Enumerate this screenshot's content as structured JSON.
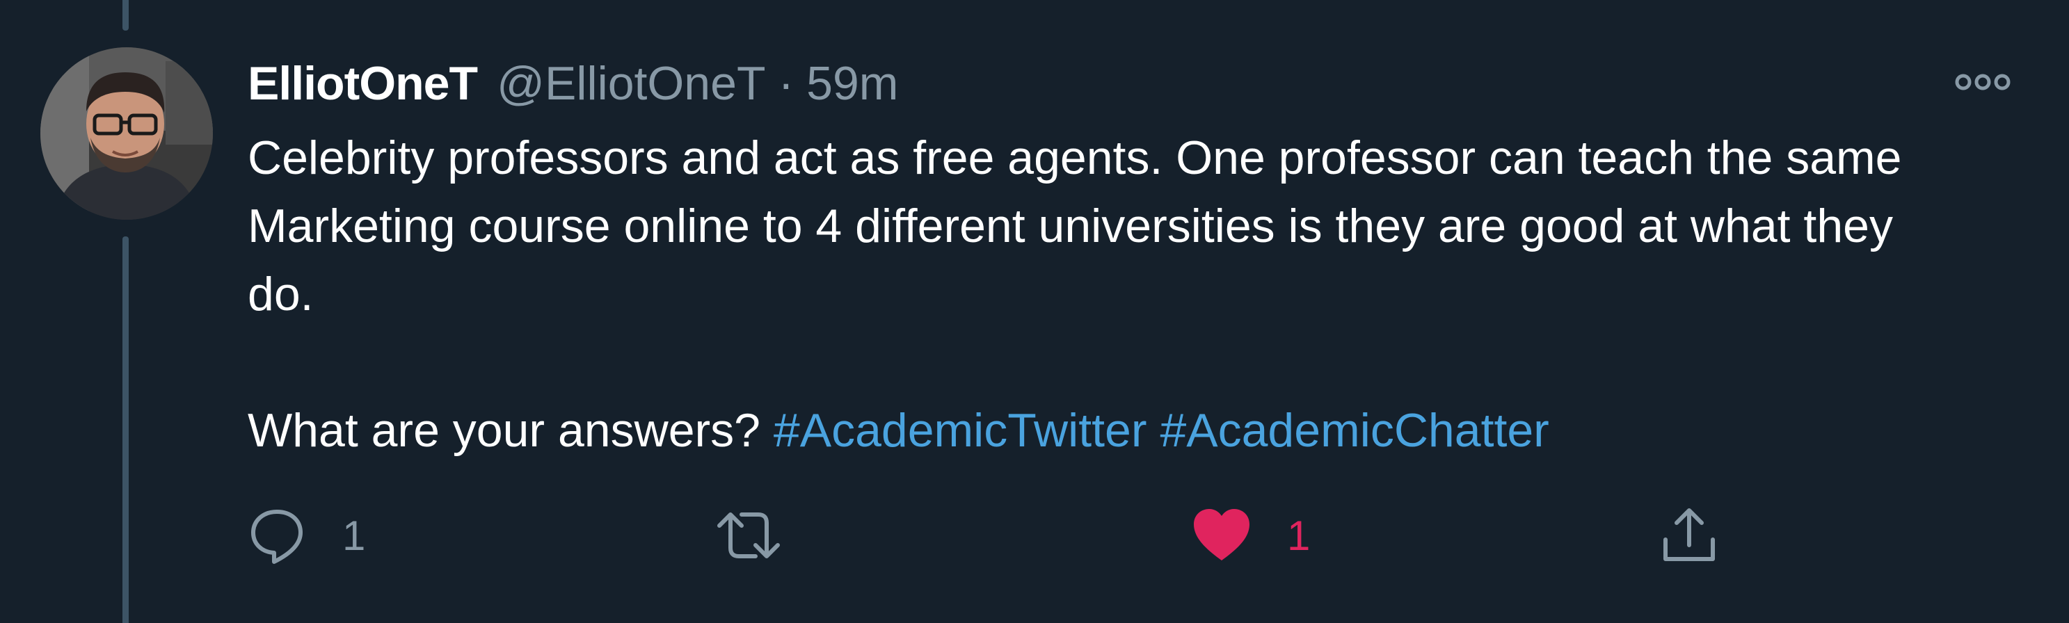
{
  "author": {
    "display_name": "ElliotOneT",
    "handle": "@ElliotOneT",
    "separator": "·",
    "time_ago": "59m"
  },
  "tweet": {
    "lines": [
      "Celebrity professors and act as free agents. One professor can teach the same",
      "Marketing course online to 4 different universities is they are good at what they",
      "do."
    ],
    "question": "What are your answers?",
    "hashtags": [
      "#AcademicTwitter",
      "#AcademicChatter"
    ]
  },
  "actions": {
    "reply_count": "1",
    "retweet_count": "",
    "like_count": "1",
    "liked": true
  },
  "icons": {
    "more": "more-horizontal-icon",
    "reply": "reply-icon",
    "retweet": "retweet-icon",
    "like": "heart-icon",
    "share": "share-icon"
  },
  "colors": {
    "background": "#15202b",
    "text_primary": "#ffffff",
    "text_secondary": "#8899a6",
    "link": "#4aa3df",
    "like": "#e0245e",
    "thread_line": "#3d5466"
  }
}
